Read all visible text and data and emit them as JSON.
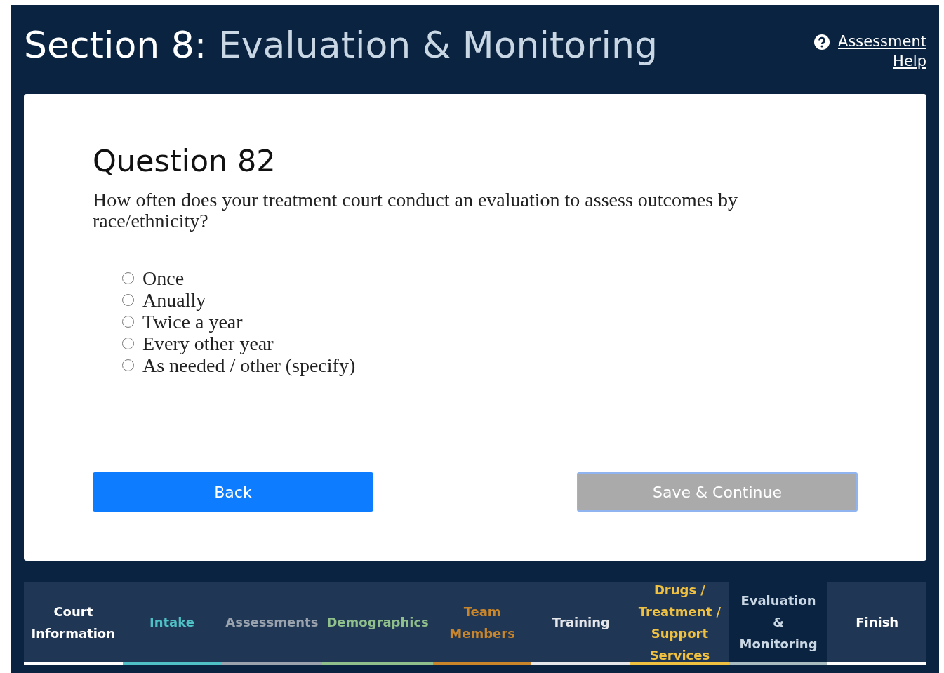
{
  "header": {
    "section_label": "Section 8:",
    "section_title": "Evaluation & Monitoring",
    "help_link": "Assessment Help"
  },
  "question": {
    "title": "Question 82",
    "text": "How often does your treatment court conduct an evaluation to assess outcomes by race/ethnicity?",
    "options": [
      {
        "label": "Once",
        "selected": false
      },
      {
        "label": "Anually",
        "selected": false
      },
      {
        "label": "Twice a year",
        "selected": false
      },
      {
        "label": "Every other year",
        "selected": false
      },
      {
        "label": "As needed / other (specify)",
        "selected": false
      }
    ]
  },
  "buttons": {
    "back": {
      "label": "Back",
      "disabled": false
    },
    "continue": {
      "label": "Save & Continue",
      "disabled": true
    }
  },
  "tabs": [
    {
      "label": "Court Information",
      "color": "#ffffff",
      "selected": false
    },
    {
      "label": "Intake",
      "color": "#4fc1c6",
      "selected": false
    },
    {
      "label": "Assessments",
      "color": "#9aa3ad",
      "selected": false
    },
    {
      "label": "Demographics",
      "color": "#8fbf8a",
      "selected": false
    },
    {
      "label": "Team Members",
      "color": "#c9852a",
      "selected": false
    },
    {
      "label": "Training",
      "color": "#e4e6ea",
      "selected": false
    },
    {
      "label": "Drugs / Treatment / Support Services",
      "color": "#f0c040",
      "selected": false
    },
    {
      "label": "Evaluation & Monitoring",
      "color": "#a9bcc0",
      "selected": true
    },
    {
      "label": "Finish",
      "color": "#ffffff",
      "selected": false
    }
  ]
}
